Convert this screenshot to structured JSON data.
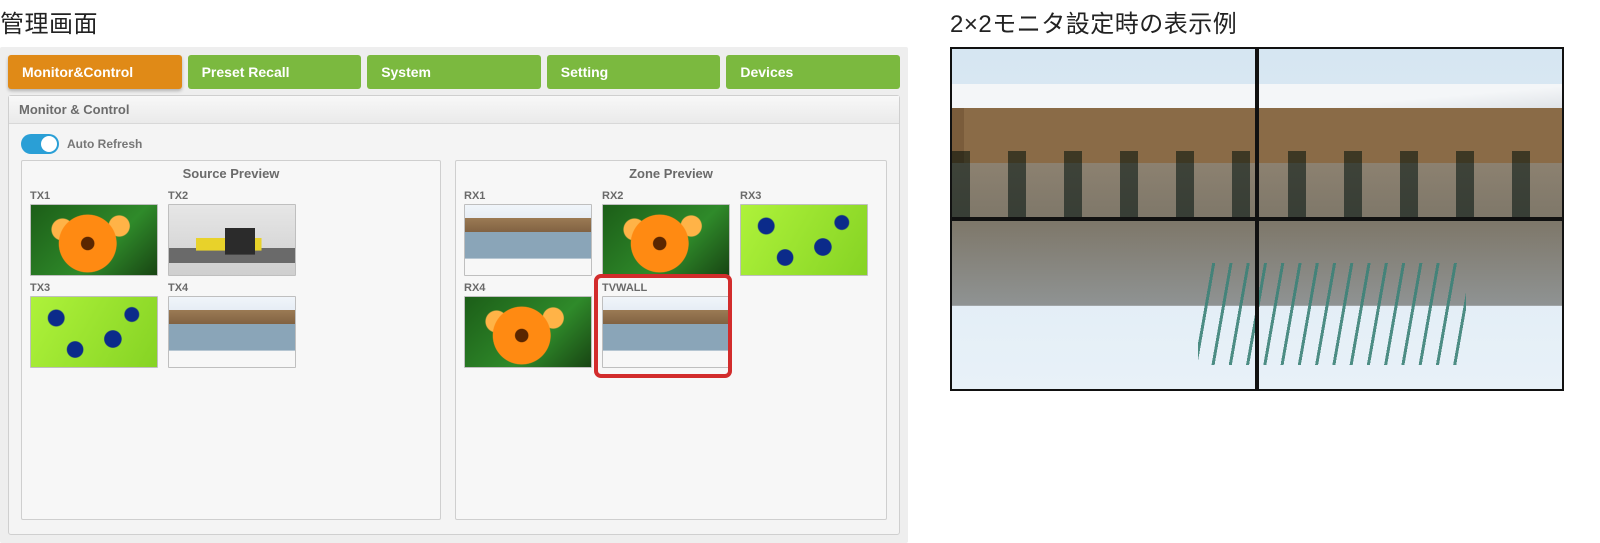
{
  "left_title": "管理画面",
  "right_title": "2×2モニタ設定時の表示例",
  "tabs": [
    {
      "label": "Monitor&Control",
      "active": true
    },
    {
      "label": "Preset Recall",
      "active": false
    },
    {
      "label": "System",
      "active": false
    },
    {
      "label": "Setting",
      "active": false
    },
    {
      "label": "Devices",
      "active": false
    }
  ],
  "panel_title": "Monitor & Control",
  "auto_refresh": {
    "label": "Auto Refresh",
    "on": true
  },
  "source_preview": {
    "title": "Source Preview",
    "items": [
      {
        "label": "TX1",
        "paint": "flower"
      },
      {
        "label": "TX2",
        "paint": "train"
      },
      {
        "label": "TX3",
        "paint": "pattern"
      },
      {
        "label": "TX4",
        "paint": "canal"
      }
    ]
  },
  "zone_preview": {
    "title": "Zone Preview",
    "items": [
      {
        "label": "RX1",
        "paint": "canal",
        "highlight": false
      },
      {
        "label": "RX2",
        "paint": "flower",
        "highlight": false
      },
      {
        "label": "RX3",
        "paint": "pattern",
        "highlight": false
      },
      {
        "label": "RX4",
        "paint": "flower",
        "highlight": false
      },
      {
        "label": "TVWALL",
        "paint": "canal",
        "highlight": true
      }
    ]
  },
  "colors": {
    "tab_active": "#e08a17",
    "tab_inactive": "#7bb93f",
    "highlight_border": "#d22c2c",
    "toggle_on": "#2a9fd6"
  }
}
